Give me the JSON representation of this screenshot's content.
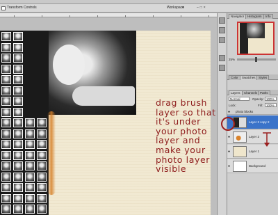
{
  "options_bar": {
    "transform_controls_label": "Transform Controls",
    "workspace_label": "Workspace",
    "workspace_arrow": "▾",
    "window_buttons": "–□×"
  },
  "navigator": {
    "tabs": [
      "Navigator",
      "Histogram",
      "Info"
    ],
    "zoom": "25%"
  },
  "swatches": {
    "tabs": [
      "Color",
      "Swatches",
      "Styles"
    ]
  },
  "layers_panel": {
    "tabs": [
      "Layers",
      "Channels",
      "Paths"
    ],
    "blend_mode": "Normal",
    "opacity_label": "Opacity:",
    "opacity_value": "100%",
    "lock_label": "Lock:",
    "fill_label": "Fill:",
    "fill_value": "100%",
    "group_name": "photo blocks",
    "layers": [
      {
        "name": "Layer 2 copy 2",
        "selected": true
      },
      {
        "name": "Layer 2",
        "selected": false
      },
      {
        "name": "Layer 1",
        "selected": false
      },
      {
        "name": "Background",
        "selected": false
      }
    ]
  },
  "annotation": {
    "lines": [
      "drag brush",
      "layer so that",
      "it's under",
      "your photo",
      "layer and",
      "make your",
      "photo layer",
      "visible"
    ],
    "color": "#8e1c1c"
  }
}
